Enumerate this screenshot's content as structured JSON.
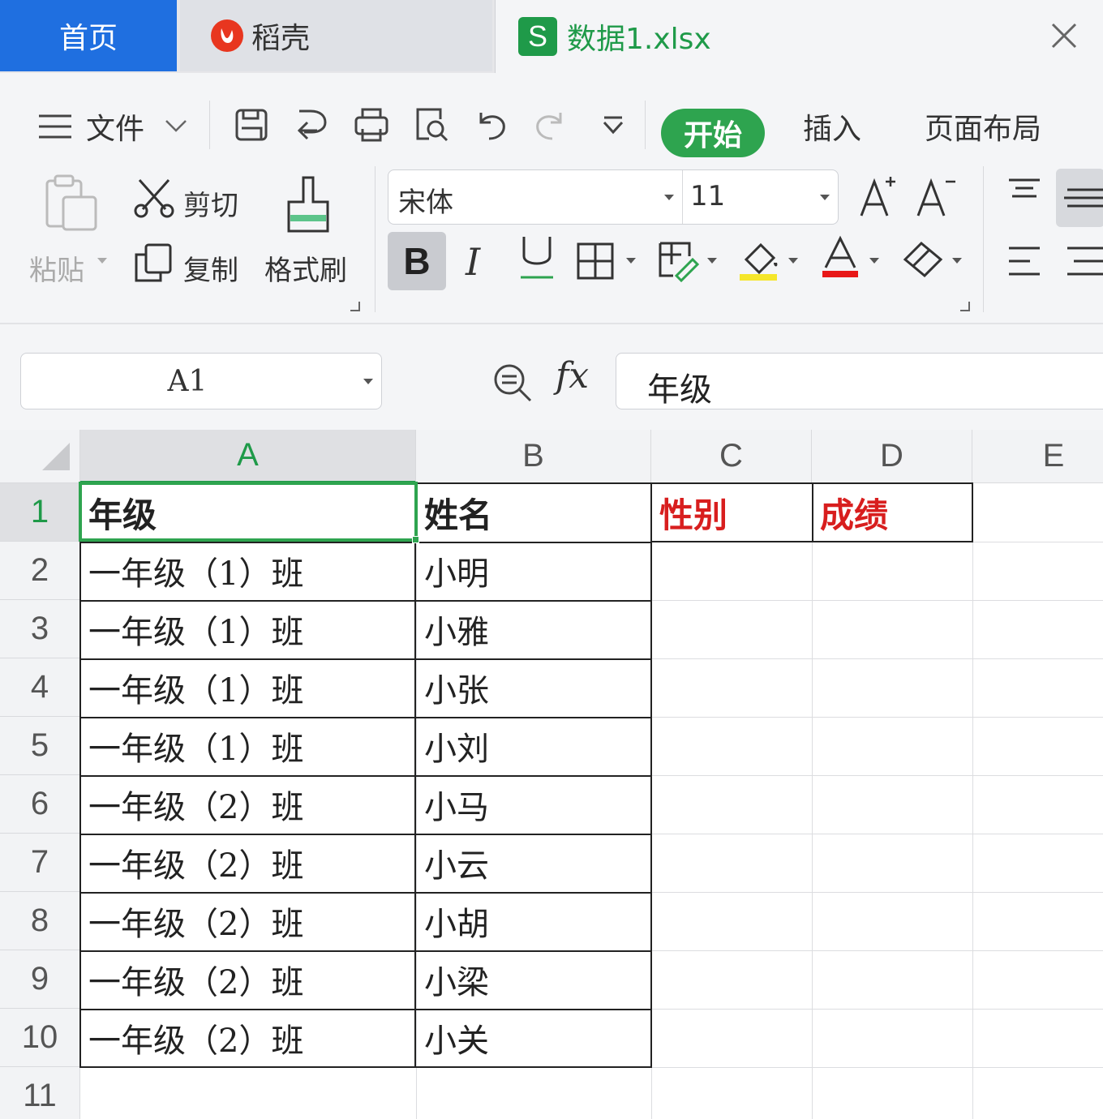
{
  "tabs": {
    "home": "首页",
    "daoke": "稻壳",
    "file_logo": "S",
    "file": "数据1.xlsx"
  },
  "menu": {
    "file_label": "文件",
    "start": "开始",
    "insert": "插入",
    "page_layout": "页面布局"
  },
  "toolbar": {
    "paste": "粘贴",
    "cut": "剪切",
    "copy": "复制",
    "format_painter": "格式刷",
    "font_name": "宋体",
    "font_size": "11",
    "bold": "B",
    "italic": "I",
    "underline": "U",
    "font_color_letter": "A",
    "font_color": "#e81818",
    "fill_color": "#f5e62a"
  },
  "formula_bar": {
    "name_box": "A1",
    "fx": "fx",
    "content": "年级"
  },
  "sheet": {
    "columns": [
      "A",
      "B",
      "C",
      "D",
      "E"
    ],
    "row_numbers": [
      "1",
      "2",
      "3",
      "4",
      "5",
      "6",
      "7",
      "8",
      "9",
      "10",
      "11"
    ],
    "header": [
      "年级",
      "姓名",
      "性别",
      "成绩"
    ],
    "rows": [
      [
        "一年级（1）班",
        "小明"
      ],
      [
        "一年级（1）班",
        "小雅"
      ],
      [
        "一年级（1）班",
        "小张"
      ],
      [
        "一年级（1）班",
        "小刘"
      ],
      [
        "一年级（2）班",
        "小马"
      ],
      [
        "一年级（2）班",
        "小云"
      ],
      [
        "一年级（2）班",
        "小胡"
      ],
      [
        "一年级（2）班",
        "小梁"
      ],
      [
        "一年级（2）班",
        "小关"
      ]
    ],
    "selected_cell": "A1",
    "accent_color": "#2ea44f",
    "header_red": "#d81e1e"
  }
}
